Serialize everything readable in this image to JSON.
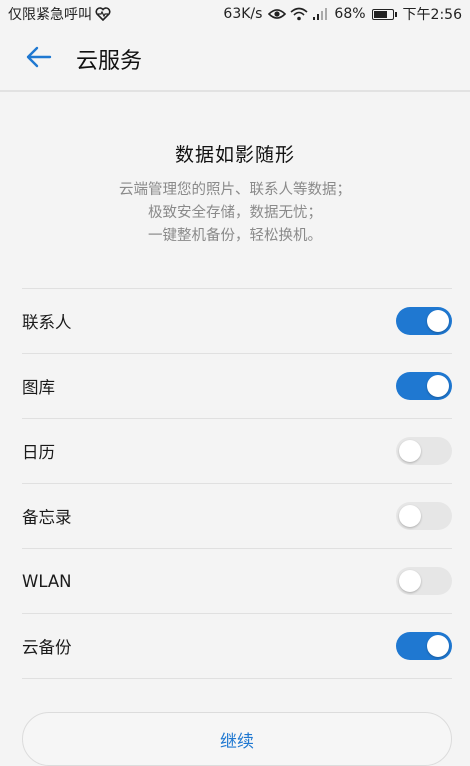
{
  "status_bar": {
    "left_text": "仅限紧急呼叫",
    "left_icon": "heart-pulse-icon",
    "speed": "63K/s",
    "battery": "68%",
    "battery_level": 0.68,
    "time": "下午2:56"
  },
  "app_bar": {
    "title": "云服务",
    "back_icon": "arrow-left-icon",
    "accent": "#1f78d1"
  },
  "intro": {
    "title": "数据如影随形",
    "lines": [
      "云端管理您的照片、联系人等数据；",
      "极致安全存储，数据无忧；",
      "一键整机备份，轻松换机。"
    ]
  },
  "toggles": [
    {
      "label": "联系人",
      "on": true
    },
    {
      "label": "图库",
      "on": true
    },
    {
      "label": "日历",
      "on": false
    },
    {
      "label": "备忘录",
      "on": false
    },
    {
      "label": "WLAN",
      "on": false
    },
    {
      "label": "云备份",
      "on": true
    }
  ],
  "continue_label": "继续",
  "colors": {
    "toggle_on": "#1f78d1",
    "toggle_off": "#e6e6e6",
    "muted_text": "#8a8a8a"
  }
}
